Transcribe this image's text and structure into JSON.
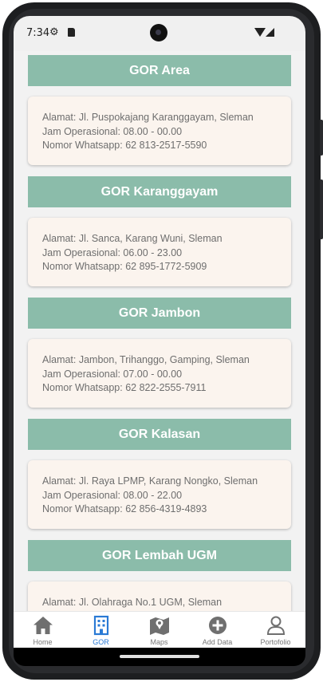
{
  "status_bar": {
    "time": "7:34"
  },
  "gor_list": [
    {
      "name": "GOR Area",
      "alamat": "Alamat: Jl. Puspokajang Karanggayam, Sleman",
      "jam": "Jam Operasional: 08.00 - 00.00",
      "whatsapp": "Nomor Whatsapp: 62 813-2517-5590"
    },
    {
      "name": "GOR Karanggayam",
      "alamat": "Alamat: Jl. Sanca, Karang Wuni, Sleman",
      "jam": "Jam Operasional: 06.00 - 23.00",
      "whatsapp": "Nomor Whatsapp: 62 895-1772-5909"
    },
    {
      "name": "GOR Jambon",
      "alamat": "Alamat: Jambon, Trihanggo, Gamping, Sleman",
      "jam": "Jam Operasional: 07.00 - 00.00",
      "whatsapp": "Nomor Whatsapp: 62 822-2555-7911"
    },
    {
      "name": "GOR Kalasan",
      "alamat": "Alamat: Jl. Raya LPMP, Karang Nongko, Sleman",
      "jam": "Jam Operasional: 08.00 - 22.00",
      "whatsapp": "Nomor Whatsapp: 62 856-4319-4893"
    },
    {
      "name": "GOR Lembah UGM",
      "alamat": "Alamat: Jl. Olahraga No.1 UGM, Sleman",
      "jam": "",
      "whatsapp": ""
    }
  ],
  "bottom_nav": [
    {
      "label": "Home",
      "icon": "home-icon",
      "active": false
    },
    {
      "label": "GOR",
      "icon": "building-icon",
      "active": true
    },
    {
      "label": "Maps",
      "icon": "map-icon",
      "active": false
    },
    {
      "label": "Add Data",
      "icon": "add-circle-icon",
      "active": false
    },
    {
      "label": "Portofolio",
      "icon": "person-icon",
      "active": false
    }
  ],
  "colors": {
    "header_bg": "#8bbcaa",
    "card_bg": "#fbf4ee",
    "active_nav": "#2a7ad5",
    "inactive_nav": "#777777"
  }
}
